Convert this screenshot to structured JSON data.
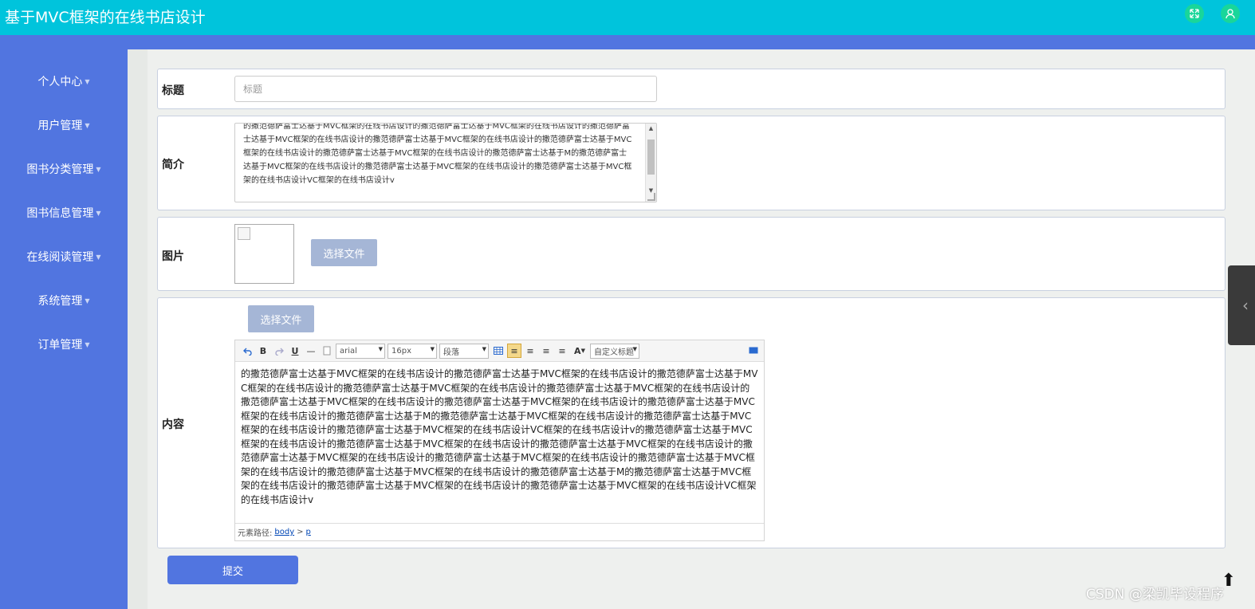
{
  "header": {
    "title": "基于MVC框架的在线书店设计",
    "fullscreen_icon": "expand-icon",
    "user_icon": "user-icon"
  },
  "sidebar": {
    "items": [
      {
        "label": "个人中心"
      },
      {
        "label": "用户管理"
      },
      {
        "label": "图书分类管理"
      },
      {
        "label": "图书信息管理"
      },
      {
        "label": "在线阅读管理"
      },
      {
        "label": "系统管理"
      },
      {
        "label": "订单管理"
      }
    ]
  },
  "form": {
    "title_label": "标题",
    "title_placeholder": "标题",
    "title_value": "",
    "intro_label": "简介",
    "intro_value": "的撒范德萨富士达基于MVC框架的在线书店设计的撒范德萨富士达基于MVC框架的在线书店设计的撒范德萨富士达基于MVC框架的在线书店设计的撒范德萨富士达基于MVC框架的在线书店设计的撒范德萨富士达基于MVC框架的在线书店设计的撒范德萨富士达基于MVC框架的在线书店设计的撒范德萨富士达基于M的撒范德萨富士达基于MVC框架的在线书店设计的撒范德萨富士达基于MVC框架的在线书店设计的撒范德萨富士达基于MVC框架的在线书店设计VC框架的在线书店设计v",
    "image_label": "图片",
    "image_file_button": "选择文件",
    "content_label": "内容",
    "content_file_button": "选择文件",
    "submit_label": "提交"
  },
  "editor": {
    "font_family": "arial",
    "font_size": "16px",
    "paragraph": "段落",
    "custom_title": "自定义标题",
    "bold": "B",
    "underline": "U",
    "font_color": "A",
    "body_text": "的撒范德萨富士达基于MVC框架的在线书店设计的撒范德萨富士达基于MVC框架的在线书店设计的撒范德萨富士达基于MVC框架的在线书店设计的撒范德萨富士达基于MVC框架的在线书店设计的撒范德萨富士达基于MVC框架的在线书店设计的撒范德萨富士达基于MVC框架的在线书店设计的撒范德萨富士达基于MVC框架的在线书店设计的撒范德萨富士达基于MVC框架的在线书店设计的撒范德萨富士达基于M的撒范德萨富士达基于MVC框架的在线书店设计的撒范德萨富士达基于MVC框架的在线书店设计的撒范德萨富士达基于MVC框架的在线书店设计VC框架的在线书店设计v的撒范德萨富士达基于MVC框架的在线书店设计的撒范德萨富士达基于MVC框架的在线书店设计的撒范德萨富士达基于MVC框架的在线书店设计的撒范德萨富士达基于MVC框架的在线书店设计的撒范德萨富士达基于MVC框架的在线书店设计的撒范德萨富士达基于MVC框架的在线书店设计的撒范德萨富士达基于MVC框架的在线书店设计的撒范德萨富士达基于M的撒范德萨富士达基于MVC框架的在线书店设计的撒范德萨富士达基于MVC框架的在线书店设计的撒范德萨富士达基于MVC框架的在线书店设计VC框架的在线书店设计v",
    "path_label": "元素路径:",
    "path_body": "body",
    "path_sep": ">",
    "path_p": "p"
  },
  "watermark": "CSDN @梁凯毕设程序",
  "colors": {
    "header": "#00c4dc",
    "sidebar": "#5175e0",
    "file_button": "#a5b6d6",
    "submit": "#5175e0"
  }
}
